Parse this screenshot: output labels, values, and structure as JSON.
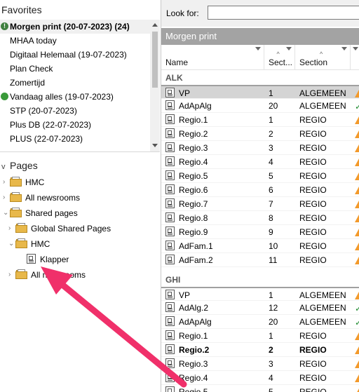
{
  "favorites": {
    "title": "Favorites",
    "items": [
      {
        "label": "Morgen print (20-07-2023) (24)",
        "bold": true,
        "marker": "alert"
      },
      {
        "label": "MHAA today",
        "bold": false,
        "marker": ""
      },
      {
        "label": "Digitaal Helemaal (19-07-2023)",
        "bold": false,
        "marker": ""
      },
      {
        "label": "Plan Check",
        "bold": false,
        "marker": ""
      },
      {
        "label": "Zomertijd",
        "bold": false,
        "marker": ""
      },
      {
        "label": "Vandaag alles (19-07-2023)",
        "bold": false,
        "marker": "green"
      },
      {
        "label": "STP (20-07-2023)",
        "bold": false,
        "marker": ""
      },
      {
        "label": "Plus DB (22-07-2023)",
        "bold": false,
        "marker": ""
      },
      {
        "label": "PLUS (22-07-2023)",
        "bold": false,
        "marker": ""
      }
    ]
  },
  "pages": {
    "title": "Pages",
    "tree": [
      {
        "label": "HMC",
        "twisty": ">",
        "icon": "folder",
        "depth": 0
      },
      {
        "label": "All newsrooms",
        "twisty": ">",
        "icon": "folder",
        "depth": 0
      },
      {
        "label": "Shared pages",
        "twisty": "v",
        "icon": "folder",
        "depth": 0
      },
      {
        "label": "Global Shared Pages",
        "twisty": ">",
        "icon": "folder",
        "depth": 1
      },
      {
        "label": "HMC",
        "twisty": "v",
        "icon": "folder",
        "depth": 1
      },
      {
        "label": "Klapper",
        "twisty": "",
        "icon": "page",
        "depth": 2
      },
      {
        "label": "All newsrooms",
        "twisty": ">",
        "icon": "folder",
        "depth": 1
      }
    ]
  },
  "search": {
    "label": "Look for:",
    "value": ""
  },
  "list": {
    "title": "Morgen print",
    "columns": [
      "Name",
      "Sect...",
      "Section"
    ],
    "groups": [
      {
        "name": "ALK",
        "rows": [
          {
            "name": "VP",
            "sec": "1",
            "section": "ALGEMEEN",
            "status": "warn",
            "selected": true,
            "bold": false
          },
          {
            "name": "AdApAlg",
            "sec": "20",
            "section": "ALGEMEEN",
            "status": "ok",
            "selected": false,
            "bold": false
          },
          {
            "name": "Regio.1",
            "sec": "1",
            "section": "REGIO",
            "status": "warn",
            "selected": false,
            "bold": false
          },
          {
            "name": "Regio.2",
            "sec": "2",
            "section": "REGIO",
            "status": "warn",
            "selected": false,
            "bold": false
          },
          {
            "name": "Regio.3",
            "sec": "3",
            "section": "REGIO",
            "status": "warn",
            "selected": false,
            "bold": false
          },
          {
            "name": "Regio.4",
            "sec": "4",
            "section": "REGIO",
            "status": "warn",
            "selected": false,
            "bold": false
          },
          {
            "name": "Regio.5",
            "sec": "5",
            "section": "REGIO",
            "status": "warn",
            "selected": false,
            "bold": false
          },
          {
            "name": "Regio.6",
            "sec": "6",
            "section": "REGIO",
            "status": "warn",
            "selected": false,
            "bold": false
          },
          {
            "name": "Regio.7",
            "sec": "7",
            "section": "REGIO",
            "status": "warn",
            "selected": false,
            "bold": false
          },
          {
            "name": "Regio.8",
            "sec": "8",
            "section": "REGIO",
            "status": "warn",
            "selected": false,
            "bold": false
          },
          {
            "name": "Regio.9",
            "sec": "9",
            "section": "REGIO",
            "status": "warn",
            "selected": false,
            "bold": false
          },
          {
            "name": "AdFam.1",
            "sec": "10",
            "section": "REGIO",
            "status": "warn",
            "selected": false,
            "bold": false
          },
          {
            "name": "AdFam.2",
            "sec": "11",
            "section": "REGIO",
            "status": "warn",
            "selected": false,
            "bold": false
          }
        ]
      },
      {
        "name": "GHI",
        "rows": [
          {
            "name": "VP",
            "sec": "1",
            "section": "ALGEMEEN",
            "status": "warn",
            "selected": false,
            "bold": false
          },
          {
            "name": "AdAlg.2",
            "sec": "12",
            "section": "ALGEMEEN",
            "status": "ok",
            "selected": false,
            "bold": false
          },
          {
            "name": "AdApAlg",
            "sec": "20",
            "section": "ALGEMEEN",
            "status": "ok",
            "selected": false,
            "bold": false
          },
          {
            "name": "Regio.1",
            "sec": "1",
            "section": "REGIO",
            "status": "warn",
            "selected": false,
            "bold": false
          },
          {
            "name": "Regio.2",
            "sec": "2",
            "section": "REGIO",
            "status": "warn",
            "selected": false,
            "bold": true
          },
          {
            "name": "Regio.3",
            "sec": "3",
            "section": "REGIO",
            "status": "warn",
            "selected": false,
            "bold": false
          },
          {
            "name": "Regio.4",
            "sec": "4",
            "section": "REGIO",
            "status": "warn",
            "selected": false,
            "bold": false
          },
          {
            "name": "Regio.5",
            "sec": "5",
            "section": "REGIO",
            "status": "warn",
            "selected": false,
            "bold": false
          }
        ]
      }
    ]
  },
  "colors": {
    "accent_arrow": "#f0306a",
    "title_bar": "#a3a3a3",
    "warn": "#f39a2b",
    "ok": "#1d8a2e"
  }
}
